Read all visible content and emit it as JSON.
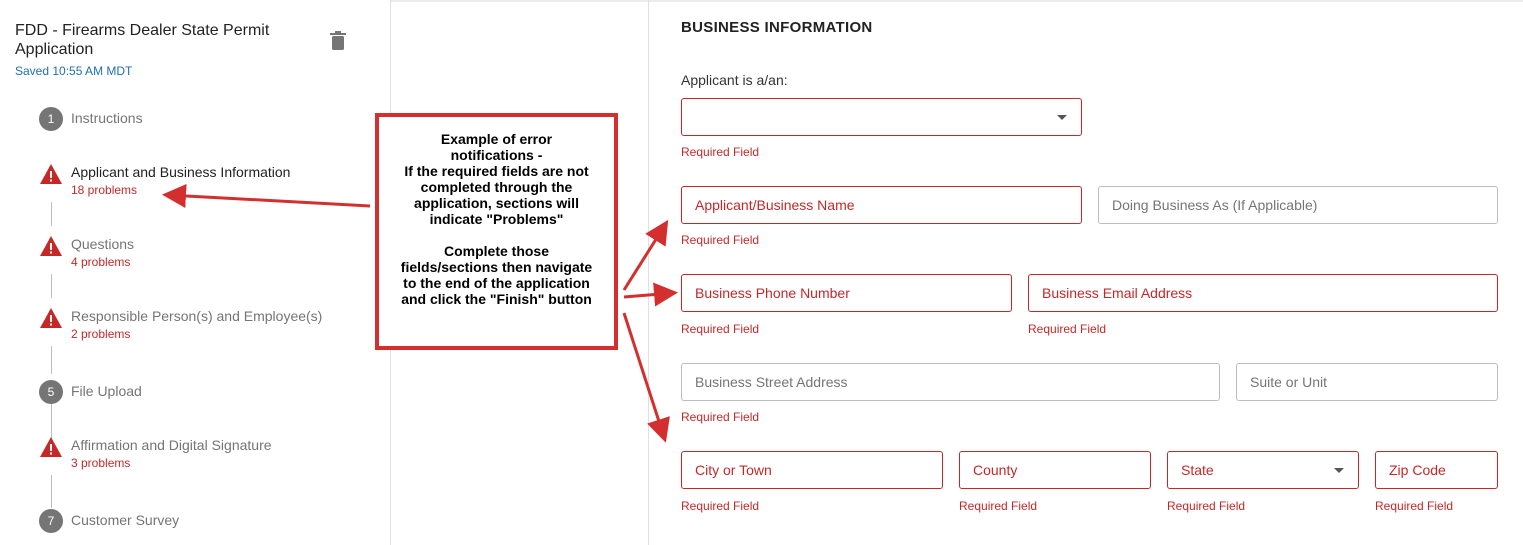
{
  "sidebar": {
    "title": "FDD - Firearms Dealer State Permit Application",
    "saved": "Saved 10:55 AM MDT",
    "steps": [
      {
        "num": "1",
        "label": "Instructions",
        "problems": ""
      },
      {
        "num": "",
        "label": "Applicant and Business Information",
        "problems": "18 problems"
      },
      {
        "num": "",
        "label": "Questions",
        "problems": "4 problems"
      },
      {
        "num": "",
        "label": "Responsible Person(s) and Employee(s)",
        "problems": "2 problems"
      },
      {
        "num": "5",
        "label": "File Upload",
        "problems": ""
      },
      {
        "num": "",
        "label": "Affirmation and Digital Signature",
        "problems": "3 problems"
      },
      {
        "num": "7",
        "label": "Customer Survey",
        "problems": ""
      }
    ]
  },
  "form": {
    "section_title": "BUSINESS INFORMATION",
    "applicant_label": "Applicant is a/an:",
    "required": "Required Field",
    "business_name": "Applicant/Business Name",
    "dba": "Doing Business As (If Applicable)",
    "phone": "Business Phone Number",
    "email": "Business Email Address",
    "street": "Business Street Address",
    "suite": "Suite or Unit",
    "city": "City or Town",
    "county": "County",
    "state": "State",
    "zip": "Zip Code"
  },
  "annotation": {
    "line1": "Example of error",
    "line2": "notifications -",
    "line3": "If the required fields are not",
    "line4": "completed through the",
    "line5": "application, sections will",
    "line6": "indicate \"Problems\"",
    "line7": "Complete those",
    "line8": "fields/sections then navigate",
    "line9": "to the end of the application",
    "line10": "and click the \"Finish\" button"
  },
  "colors": {
    "error": "#c62828",
    "link": "#1f6fb2",
    "annotation": "#d32f2f"
  }
}
